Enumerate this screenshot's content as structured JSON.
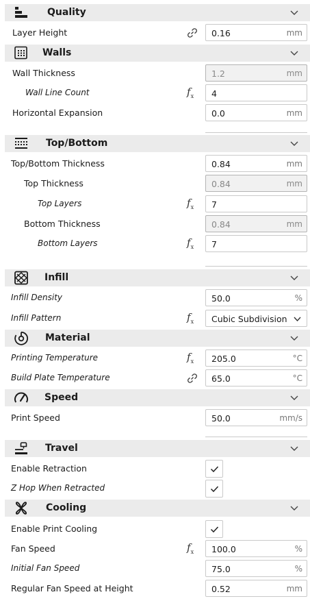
{
  "categories": {
    "quality": "Quality",
    "walls": "Walls",
    "topbottom": "Top/Bottom",
    "infill": "Infill",
    "material": "Material",
    "speed": "Speed",
    "travel": "Travel",
    "cooling": "Cooling"
  },
  "settings": {
    "layer_height": {
      "label": "Layer Height",
      "value": "0.16",
      "unit": "mm"
    },
    "wall_thickness": {
      "label": "Wall Thickness",
      "value": "1.2",
      "unit": "mm"
    },
    "wall_line_count": {
      "label": "Wall Line Count",
      "value": "4"
    },
    "horizontal_expansion": {
      "label": "Horizontal Expansion",
      "value": "0.0",
      "unit": "mm"
    },
    "top_bottom_thickness": {
      "label": "Top/Bottom Thickness",
      "value": "0.84",
      "unit": "mm"
    },
    "top_thickness": {
      "label": "Top Thickness",
      "value": "0.84",
      "unit": "mm"
    },
    "top_layers": {
      "label": "Top Layers",
      "value": "7"
    },
    "bottom_thickness": {
      "label": "Bottom Thickness",
      "value": "0.84",
      "unit": "mm"
    },
    "bottom_layers": {
      "label": "Bottom Layers",
      "value": "7"
    },
    "infill_density": {
      "label": "Infill Density",
      "value": "50.0",
      "unit": "%"
    },
    "infill_pattern": {
      "label": "Infill Pattern",
      "value": "Cubic Subdivision"
    },
    "printing_temperature": {
      "label": "Printing Temperature",
      "value": "205.0",
      "unit": "°C"
    },
    "build_plate_temperature": {
      "label": "Build Plate Temperature",
      "value": "65.0",
      "unit": "°C"
    },
    "print_speed": {
      "label": "Print Speed",
      "value": "50.0",
      "unit": "mm/s"
    },
    "enable_retraction": {
      "label": "Enable Retraction",
      "checked": true
    },
    "z_hop": {
      "label": "Z Hop When Retracted",
      "checked": true
    },
    "enable_print_cooling": {
      "label": "Enable Print Cooling",
      "checked": true
    },
    "fan_speed": {
      "label": "Fan Speed",
      "value": "100.0",
      "unit": "%"
    },
    "initial_fan_speed": {
      "label": "Initial Fan Speed",
      "value": "75.0",
      "unit": "%"
    },
    "regular_fan_speed_height": {
      "label": "Regular Fan Speed at Height",
      "value": "0.52",
      "unit": "mm"
    }
  },
  "icons": {
    "linked": "link-icon",
    "function": "fx-icon",
    "chevron": "chevron-down-icon"
  },
  "colors": {
    "category_bg": "#ebebeb",
    "field_border": "#c9c9c9",
    "disabled_bg": "#f1f1f1"
  }
}
